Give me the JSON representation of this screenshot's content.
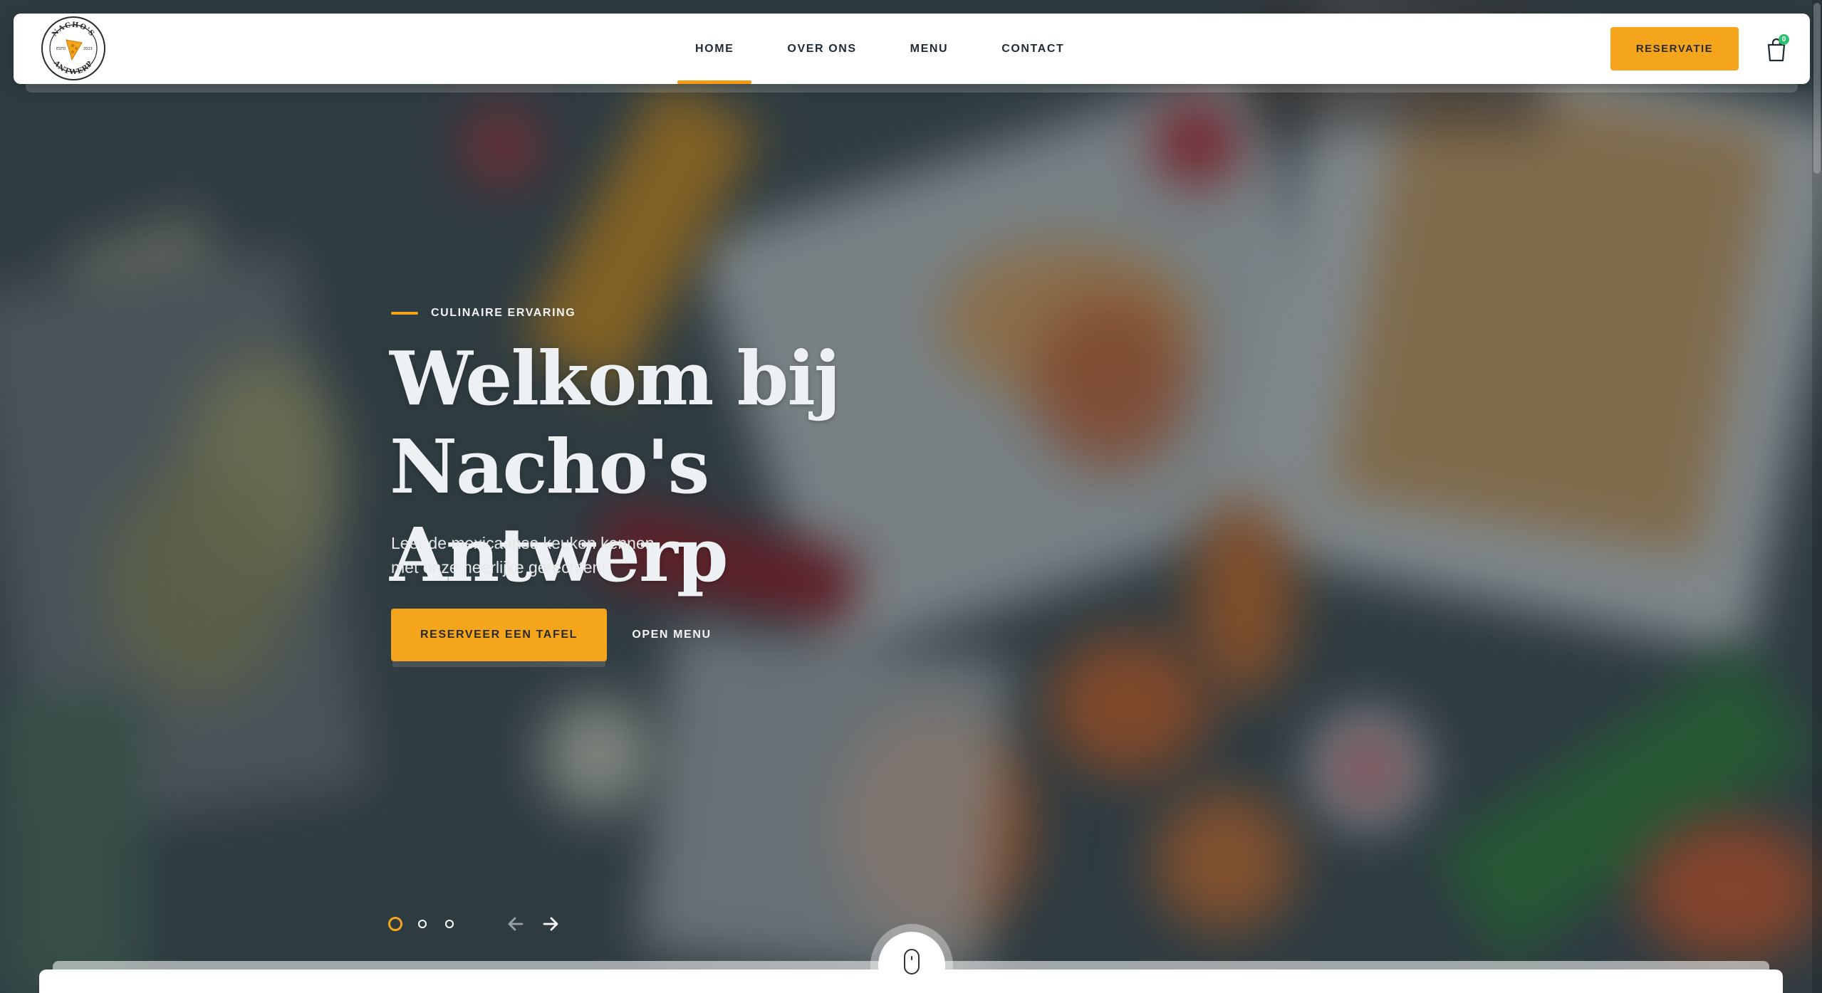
{
  "brand": {
    "logo_top_text": "NACHO'S",
    "logo_bottom_text": "ANTWERP",
    "logo_left_text": "ESTD",
    "logo_right_text": "2023"
  },
  "nav": {
    "items": [
      {
        "label": "HOME",
        "active": true
      },
      {
        "label": "OVER ONS",
        "active": false
      },
      {
        "label": "MENU",
        "active": false
      },
      {
        "label": "CONTACT",
        "active": false
      }
    ],
    "reserve_label": "RESERVATIE",
    "cart_icon": "shopping-bag-icon",
    "cart_count": "0"
  },
  "hero": {
    "eyebrow": "CULINAIRE ERVARING",
    "title_line1": "Welkom bij",
    "title_line2": "Nacho's Antwerp",
    "subtitle_line1": "Leer de mexicaanse keuken kennen",
    "subtitle_line2": "met onze heerlijke gerechten!",
    "cta_primary": "RESERVEER EEN TAFEL",
    "cta_secondary": "OPEN MENU"
  },
  "slider": {
    "slides": 3,
    "active_index": 0,
    "prev_icon": "arrow-left-icon",
    "next_icon": "arrow-right-icon"
  },
  "scroll_icon": "mouse-scroll-icon",
  "colors": {
    "accent": "#f5a51c",
    "nav_text": "#1f2a33",
    "badge": "#2fbf71"
  }
}
